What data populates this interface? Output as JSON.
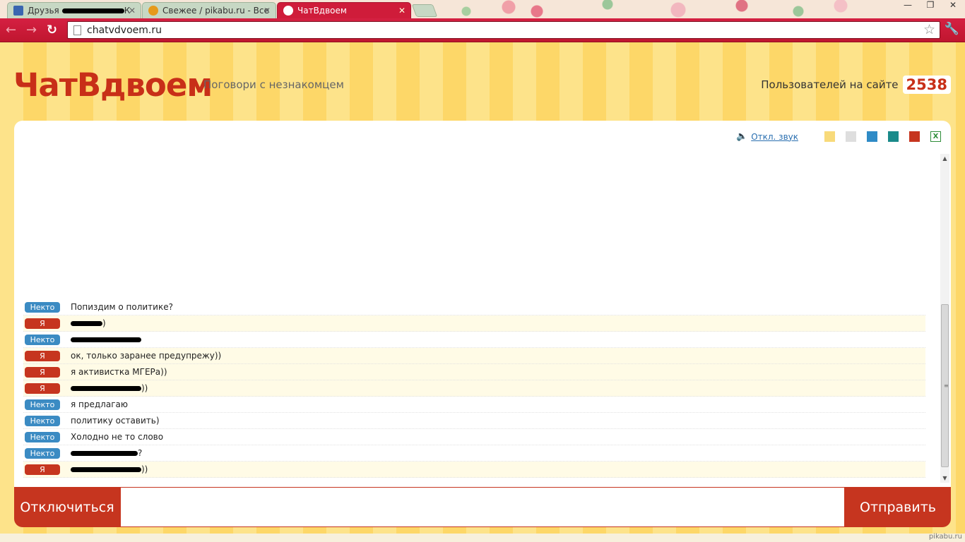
{
  "browser": {
    "tabs": [
      {
        "title": "Друзья",
        "title_tail": "К",
        "favicon_color": "#3a66b0",
        "redacted": true
      },
      {
        "title": "Свежее / pikabu.ru - Все",
        "favicon_color": "#e69a1c",
        "redacted": false
      },
      {
        "title": "ЧатВдвоем",
        "favicon_color": "#ffffff",
        "redacted": false
      }
    ],
    "url": "chatvdvoem.ru"
  },
  "site": {
    "logo": "ЧатВдвоем",
    "tagline": "Поговори с незнакомцем",
    "users_label": "Пользователей на сайте",
    "users_count": "2538",
    "mute_label": "Откл. звук",
    "theme_colors": [
      "#f8da7a",
      "#dedede",
      "#2f8bc6",
      "#1a8a8a",
      "#c6351f"
    ]
  },
  "messages": [
    {
      "sender": "Некто",
      "role": "other",
      "text": "Попиздим о политике?",
      "redacted": false
    },
    {
      "sender": "Я",
      "role": "me",
      "text": "",
      "redacted": true,
      "tail": ")"
    },
    {
      "sender": "Некто",
      "role": "other",
      "text": "",
      "redacted": true,
      "tail": ""
    },
    {
      "sender": "Я",
      "role": "me",
      "text": "ок, только заранее предупрежу))",
      "redacted": false
    },
    {
      "sender": "Я",
      "role": "me",
      "text": "я активистка МГЕРа))",
      "redacted": false
    },
    {
      "sender": "Я",
      "role": "me",
      "text": "",
      "redacted": true,
      "tail": "))"
    },
    {
      "sender": "Некто",
      "role": "other",
      "text": "я предлагаю",
      "redacted": false
    },
    {
      "sender": "Некто",
      "role": "other",
      "text": "политику оставить)",
      "redacted": false
    },
    {
      "sender": "Некто",
      "role": "other",
      "text": "Холодно не то слово",
      "redacted": false
    },
    {
      "sender": "Некто",
      "role": "other",
      "text": "",
      "redacted": true,
      "tail": "?"
    },
    {
      "sender": "Я",
      "role": "me",
      "text": "",
      "redacted": true,
      "tail": "))"
    }
  ],
  "input": {
    "disconnect_label": "Отключиться",
    "send_label": "Отправить",
    "value": ""
  },
  "watermark": "pikabu.ru"
}
